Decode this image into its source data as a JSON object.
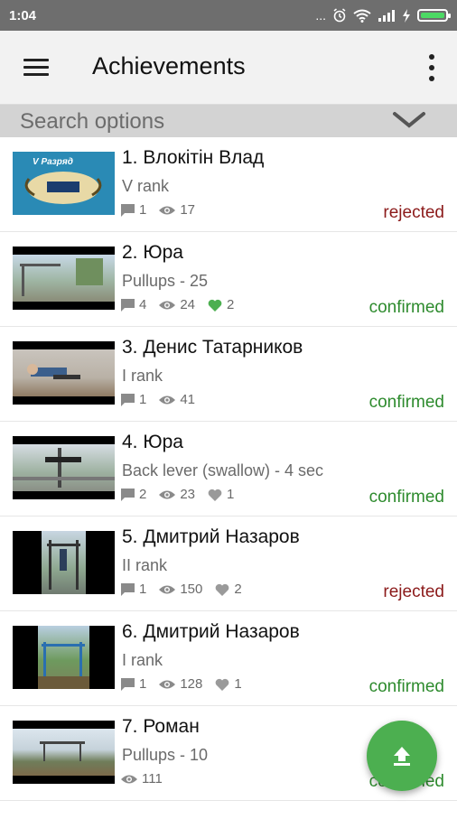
{
  "status_bar": {
    "time": "1:04",
    "dots": "...",
    "icons": [
      "alarm-icon",
      "wifi-icon",
      "signal-icon",
      "charging-icon",
      "battery-icon"
    ]
  },
  "toolbar": {
    "title": "Achievements",
    "menu_icon": "hamburger-icon",
    "overflow_icon": "more-vert-icon"
  },
  "search": {
    "label": "Search options",
    "icon": "chevron-down-icon"
  },
  "colors": {
    "rejected": "#8b1a1a",
    "confirmed": "#2e8b2e",
    "fab": "#4caf50",
    "like_active": "#4caf50"
  },
  "items": [
    {
      "name": "1. Влокітін Влад",
      "sub": "V rank",
      "comments": "1",
      "views": "17",
      "likes": null,
      "liked": false,
      "status": "rejected"
    },
    {
      "name": "2. Юра",
      "sub": "Pullups - 25",
      "comments": "4",
      "views": "24",
      "likes": "2",
      "liked": true,
      "status": "confirmed"
    },
    {
      "name": "3. Денис Татарников",
      "sub": "I rank",
      "comments": "1",
      "views": "41",
      "likes": null,
      "liked": false,
      "status": "confirmed"
    },
    {
      "name": "4. Юра",
      "sub": "Back lever (swallow) - 4 sec",
      "comments": "2",
      "views": "23",
      "likes": "1",
      "liked": false,
      "status": "confirmed"
    },
    {
      "name": "5. Дмитрий Назаров",
      "sub": "II rank",
      "comments": "1",
      "views": "150",
      "likes": "2",
      "liked": false,
      "status": "rejected"
    },
    {
      "name": "6. Дмитрий Назаров",
      "sub": "I rank",
      "comments": "1",
      "views": "128",
      "likes": "1",
      "liked": false,
      "status": "confirmed"
    },
    {
      "name": "7. Роман",
      "sub": "Pullups - 10",
      "comments": null,
      "views": "111",
      "likes": null,
      "liked": false,
      "status": "confirmed"
    }
  ],
  "thumb_texts": {
    "item1_banner": "V Разряд"
  },
  "fab": {
    "icon": "upload-icon"
  }
}
